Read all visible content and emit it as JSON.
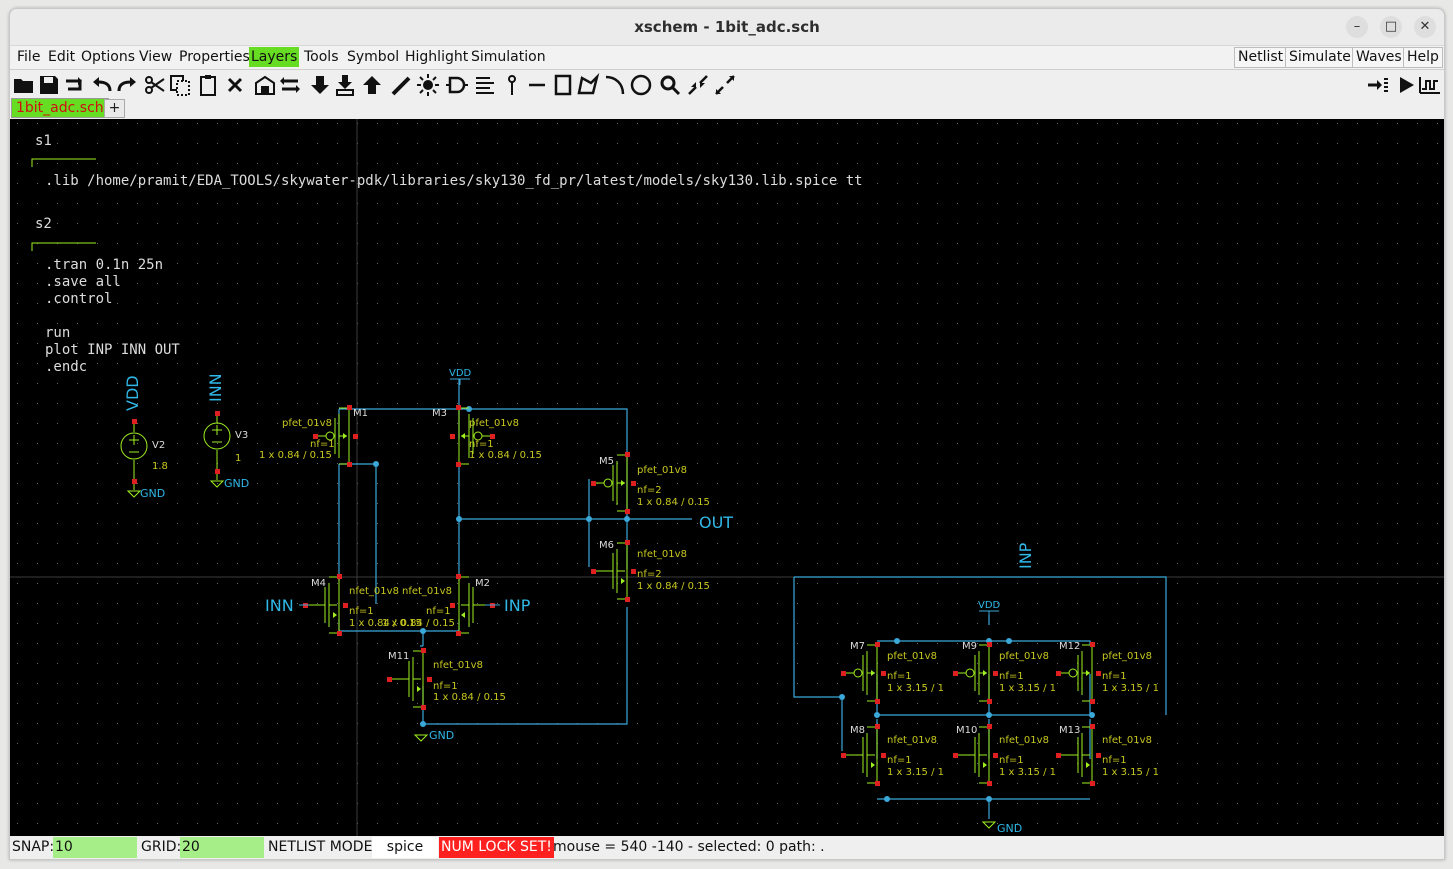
{
  "window": {
    "title": "xschem - 1bit_adc.sch"
  },
  "window_buttons": [
    "–",
    "□",
    "✕"
  ],
  "menus": [
    "File",
    "Edit",
    "Options",
    "View",
    "Properties",
    "Layers",
    "Tools",
    "Symbol",
    "Highlight",
    "Simulation"
  ],
  "right_menus": [
    "Netlist",
    "Simulate",
    "Waves",
    "Help"
  ],
  "toolbar": [
    "open-icon",
    "save-icon",
    "reload-icon",
    "undo-icon",
    "redo-icon",
    "cut-icon",
    "copy-icon",
    "paste-icon",
    "delete-icon",
    "insert-symbol-icon",
    "swap-icon",
    "push-icon",
    "descend-icon",
    "pop-icon",
    "wire-icon",
    "bulb-icon",
    "gate-icon",
    "list-icon",
    "pin-icon",
    "line-icon",
    "rect-icon",
    "polygon-icon",
    "arc-icon",
    "circle-icon",
    "zoom-icon",
    "zoom-in-icon",
    "zoom-out-icon"
  ],
  "toolbar_right": [
    "netlist-arrow-icon",
    "play-icon",
    "waves-icon"
  ],
  "tabs": {
    "active": "1bit_adc.sch",
    "add": "+"
  },
  "code_blocks": {
    "s1": {
      "name": "s1",
      "lines": [
        ".lib /home/pramit/EDA_TOOLS/skywater-pdk/libraries/sky130_fd_pr/latest/models/sky130.lib.spice tt"
      ]
    },
    "s2": {
      "name": "s2",
      "lines": [
        ".tran 0.1n 25n",
        ".save all",
        ".control",
        "",
        "run",
        "plot INP INN OUT",
        ".endc"
      ]
    }
  },
  "sources": [
    {
      "name": "V2",
      "value": "1.8",
      "net": "VDD",
      "gnd": "GND"
    },
    {
      "name": "V3",
      "value": "1",
      "net": "INN",
      "gnd": "GND"
    }
  ],
  "devices": [
    {
      "ref": "M1",
      "model": "pfet_01v8",
      "nf": "nf=1",
      "size": "1 x 0.84 / 0.15"
    },
    {
      "ref": "M3",
      "model": "pfet_01v8",
      "nf": "nf=1",
      "size": "1 x 0.84 / 0.15"
    },
    {
      "ref": "M5",
      "model": "pfet_01v8",
      "nf": "nf=2",
      "size": "1 x 0.84 / 0.15"
    },
    {
      "ref": "M6",
      "model": "nfet_01v8",
      "nf": "nf=2",
      "size": "1 x 0.84 / 0.15"
    },
    {
      "ref": "M4",
      "model": "nfet_01v8",
      "nf": "nf=1",
      "size": "1 x 0.84 / 0.15"
    },
    {
      "ref": "M2",
      "model": "nfet_01v8",
      "nf": "nf=1",
      "size": "1 x 0.84 / 0.15"
    },
    {
      "ref": "M11",
      "model": "nfet_01v8",
      "nf": "nf=1",
      "size": "1 x 0.84 / 0.15"
    },
    {
      "ref": "M7",
      "model": "pfet_01v8",
      "nf": "nf=1",
      "size": "1 x 3.15 / 1"
    },
    {
      "ref": "M9",
      "model": "pfet_01v8",
      "nf": "nf=1",
      "size": "1 x 3.15 / 1"
    },
    {
      "ref": "M12",
      "model": "pfet_01v8",
      "nf": "nf=1",
      "size": "1 x 3.15 / 1"
    },
    {
      "ref": "M8",
      "model": "nfet_01v8",
      "nf": "nf=1",
      "size": "1 x 3.15 / 1"
    },
    {
      "ref": "M10",
      "model": "nfet_01v8",
      "nf": "nf=1",
      "size": "1 x 3.15 / 1"
    },
    {
      "ref": "M13",
      "model": "nfet_01v8",
      "nf": "nf=1",
      "size": "1 x 3.15 / 1"
    }
  ],
  "net_labels": {
    "vdd": "VDD",
    "gnd": "GND",
    "out": "OUT",
    "inn": "INN",
    "inp": "INP"
  },
  "colors": {
    "wire": "#3aa8d8",
    "net": "#30b8e8",
    "attr": "#c8c820",
    "symbol": "#a0f020",
    "pin": "#e02020",
    "canvas": "#000000",
    "active": "#66dd22",
    "numlock": "#ff2020"
  },
  "status": {
    "snap_label": "SNAP:",
    "snap_value": "10",
    "grid_label": "GRID:",
    "grid_value": "20",
    "netlist_label": "NETLIST MODE:",
    "netlist_value": "spice",
    "numlock": "NUM LOCK SET!",
    "mouse": "mouse = 540 -140 - selected: 0 path: ."
  }
}
